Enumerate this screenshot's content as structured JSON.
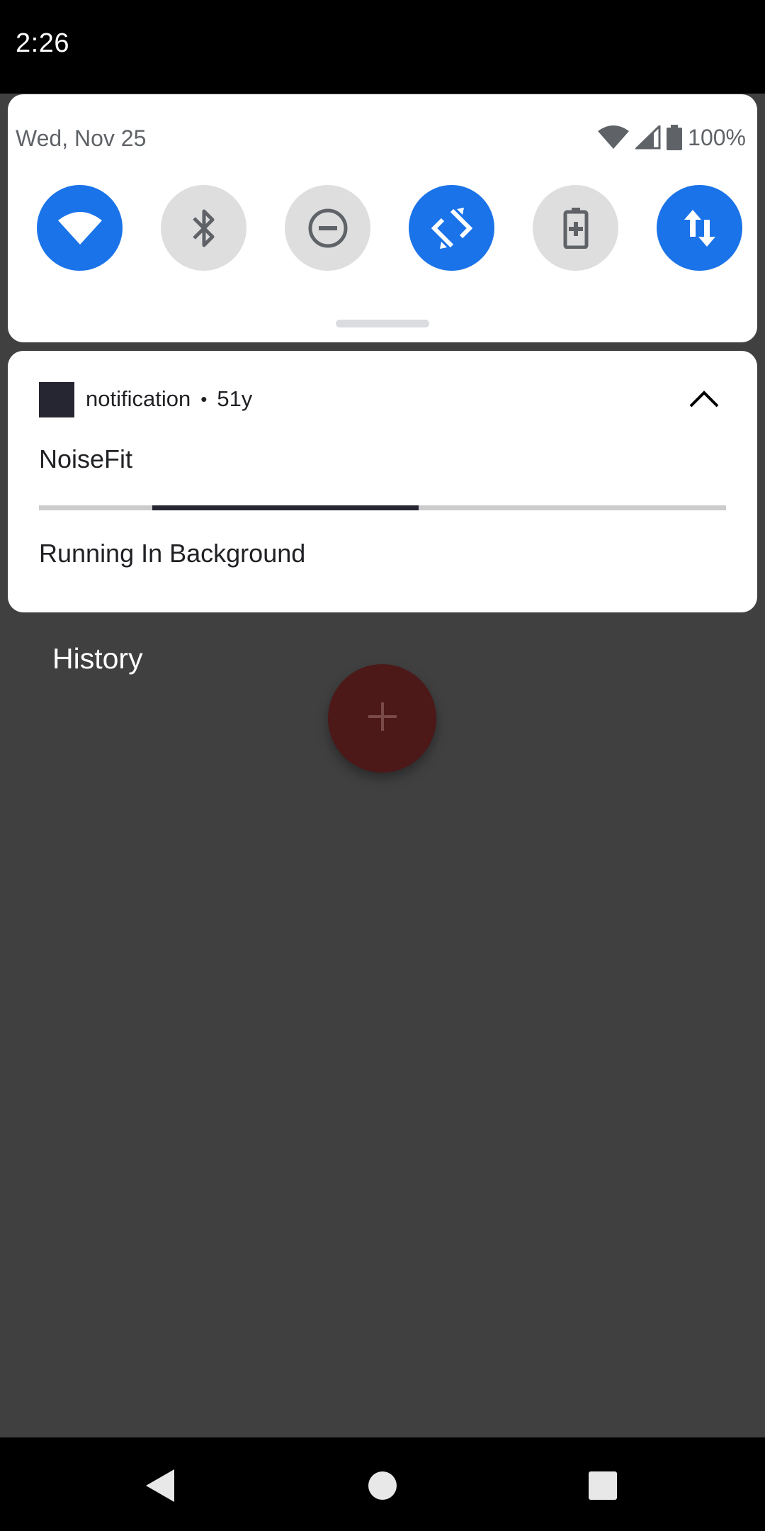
{
  "status_bar": {
    "time": "2:26"
  },
  "quick_settings": {
    "date": "Wed, Nov 25",
    "battery_percent": "100%",
    "tiles": [
      {
        "name": "wifi",
        "icon": "wifi-icon",
        "active": true
      },
      {
        "name": "bluetooth",
        "icon": "bluetooth-icon",
        "active": false
      },
      {
        "name": "do-not-disturb",
        "icon": "do-not-disturb-icon",
        "active": false
      },
      {
        "name": "auto-rotate",
        "icon": "auto-rotate-icon",
        "active": true
      },
      {
        "name": "battery-saver",
        "icon": "battery-saver-icon",
        "active": false
      },
      {
        "name": "mobile-data",
        "icon": "mobile-data-icon",
        "active": true
      }
    ],
    "colors": {
      "active_tile": "#1a73e8",
      "inactive_tile": "#dedede"
    }
  },
  "notification": {
    "app_name": "notification",
    "separator": "•",
    "age": "51y",
    "title": "NoiseFit",
    "text": "Running In Background",
    "progress": {
      "indeterminate": true,
      "segment_start": 0.165,
      "segment_end": 0.553
    }
  },
  "app": {
    "history_label": "History",
    "fab_icon": "plus-icon",
    "fab_color": "#4c1818"
  },
  "nav_bar": {
    "back_icon": "back-icon",
    "home_icon": "home-icon",
    "recents_icon": "recents-icon"
  }
}
